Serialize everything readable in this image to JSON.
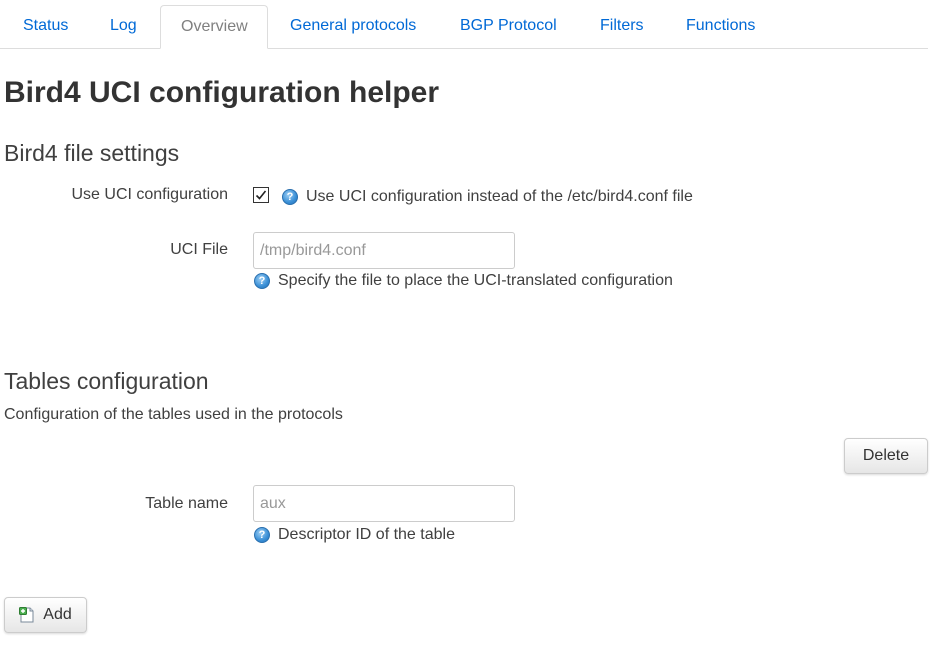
{
  "tabs": [
    {
      "label": "Status"
    },
    {
      "label": "Log"
    },
    {
      "label": "Overview"
    },
    {
      "label": "General protocols"
    },
    {
      "label": "BGP Protocol"
    },
    {
      "label": "Filters"
    },
    {
      "label": "Functions"
    }
  ],
  "page_title": "Bird4 UCI configuration helper",
  "file_settings": {
    "heading": "Bird4 file settings",
    "use_uci": {
      "label": "Use UCI configuration",
      "checked": true,
      "help": "Use UCI configuration instead of the /etc/bird4.conf file"
    },
    "uci_file": {
      "label": "UCI File",
      "placeholder": "/tmp/bird4.conf",
      "value": "",
      "help": "Specify the file to place the UCI-translated configuration"
    }
  },
  "tables": {
    "heading": "Tables configuration",
    "description": "Configuration of the tables used in the protocols",
    "delete_label": "Delete",
    "table_name": {
      "label": "Table name",
      "placeholder": "aux",
      "value": "",
      "help": "Descriptor ID of the table"
    },
    "add_label": "Add"
  },
  "colors": {
    "link": "#0069d6",
    "active_tab": "#808080",
    "text": "#404040",
    "border": "#dddddd"
  },
  "icons": {
    "help": "help-icon",
    "add": "add-icon",
    "check": "checkmark-icon"
  }
}
